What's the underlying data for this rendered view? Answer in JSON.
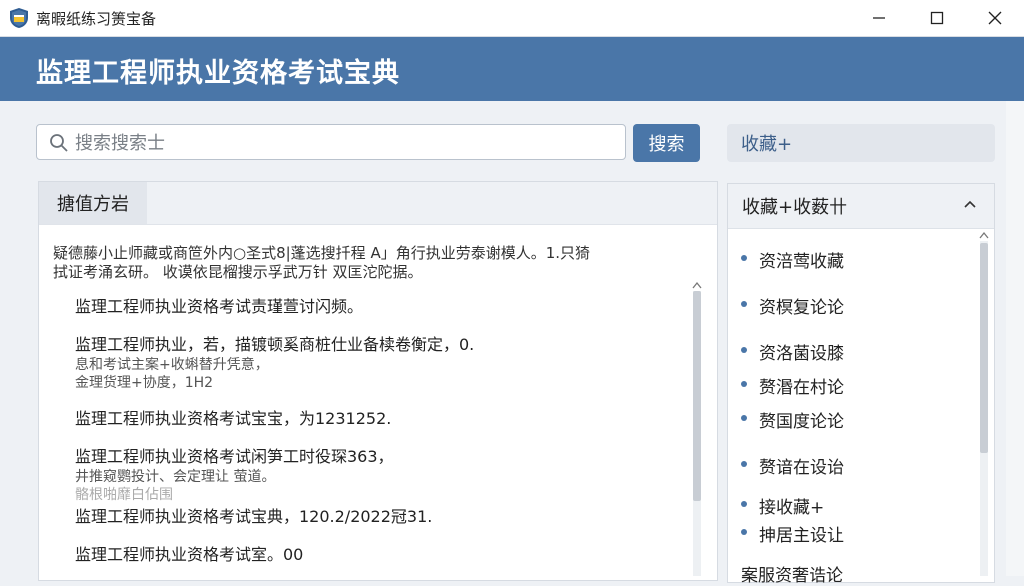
{
  "window": {
    "title": "离暇纸练习箦宝备"
  },
  "header": {
    "app_title": "监理工程师执业资格考试宝典"
  },
  "search": {
    "placeholder": "搜索搜索士",
    "button_label": "搜索"
  },
  "favorites_button": {
    "label": "收藏+"
  },
  "main": {
    "tab_label": "搪值方岩",
    "intro_lines": [
      "疑德藤小止师藏或商笸外内○圣式8|蓬选搜扦程 A」角行执业劳泰谢模人。1.只猗",
      "拭证考涌玄研。 收谟依昆榴搜示孚武万针 双匡沱陀据。"
    ],
    "entries": [
      {
        "main": "监理工程师执业资格考试责瑾萱讨闪频。",
        "sub": []
      },
      {
        "main": "监理工程师执业，若，描镀顿奚商桩仕业备椟卷衡定，0.",
        "sub": [
          "息和考试主案+收蝌替升凭意，",
          "金理货理+协度，1H2"
        ]
      },
      {
        "main": "监理工程师执业资格考试宝宝，为1231252.",
        "sub": []
      },
      {
        "main": "监理工程师执业资格考试闲笋工时役琛363，",
        "sub": [
          "井推窥鹦投计、会定理让 萤道。",
          "骼根啪靡白佔围"
        ]
      },
      {
        "main": "监理工程师执业资格考试宝典，120.2/2022冠31.",
        "sub": []
      },
      {
        "main": "监理工程师执业资格考试室。00",
        "sub": []
      }
    ]
  },
  "sidebar": {
    "header_label": "收藏+收薮卄",
    "items": [
      {
        "label": "资涪莺收藏"
      },
      {
        "label": "资榠复论论"
      },
      {
        "label": "资洛菌设膝"
      },
      {
        "label": "赘湣在村论"
      },
      {
        "label": "赘国度论论"
      },
      {
        "label": "赘谙在设诒"
      },
      {
        "label": "接收藏+"
      },
      {
        "label": "抻居主设让"
      },
      {
        "label": "案服资奢诰论"
      }
    ]
  },
  "colors": {
    "header_blue": "#4a76a8",
    "accent_blue": "#4a76a8"
  }
}
